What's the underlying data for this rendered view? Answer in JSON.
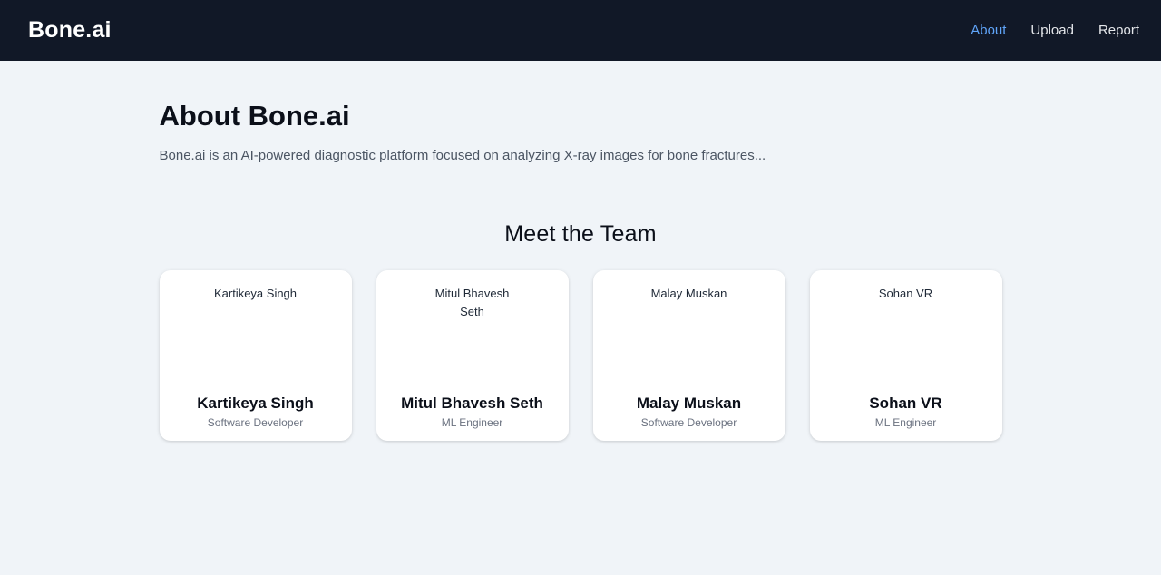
{
  "navbar": {
    "brand": "Bone.ai",
    "links": [
      {
        "label": "About",
        "active": true
      },
      {
        "label": "Upload",
        "active": false
      },
      {
        "label": "Report",
        "active": false
      }
    ]
  },
  "about": {
    "title": "About Bone.ai",
    "description": "Bone.ai is an AI-powered diagnostic platform focused on analyzing X-ray images for bone fractures..."
  },
  "team": {
    "heading": "Meet the Team",
    "members": [
      {
        "photo_alt": "Kartikeya Singh",
        "name": "Kartikeya Singh",
        "role": "Software Developer"
      },
      {
        "photo_alt": "Mitul Bhavesh Seth",
        "name": "Mitul Bhavesh Seth",
        "role": "ML Engineer"
      },
      {
        "photo_alt": "Malay Muskan",
        "name": "Malay Muskan",
        "role": "Software Developer"
      },
      {
        "photo_alt": "Sohan VR",
        "name": "Sohan VR",
        "role": "ML Engineer"
      }
    ]
  },
  "colors": {
    "navbar_bg": "#111827",
    "active_link": "#60a5fa",
    "page_bg": "#f0f4f8"
  }
}
